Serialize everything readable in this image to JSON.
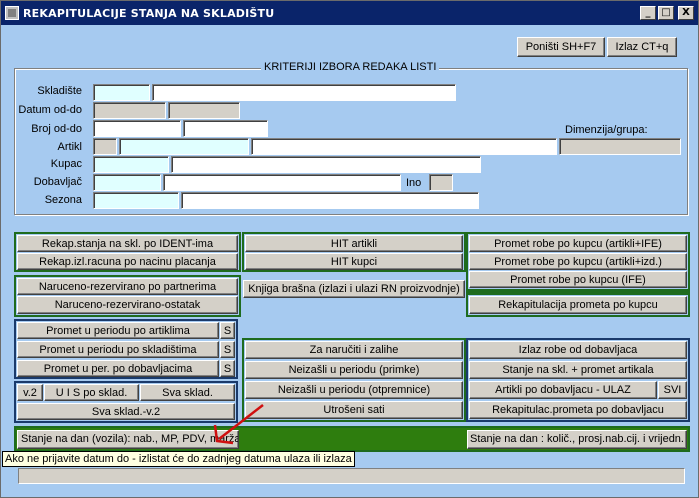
{
  "window": {
    "title": "REKAPITULACIJE STANJA NA SKLADIŠTU",
    "controls": {
      "minimize": "_",
      "maximize": "□",
      "close": "X"
    }
  },
  "top_buttons": {
    "cancel": "Poništi SH+F7",
    "exit": "Izlaz CT+q"
  },
  "criteria": {
    "title": "KRITERIJI IZBORA REDAKA LISTI",
    "labels": {
      "skladiste": "Skladište",
      "datum": "Datum od-do",
      "broj": "Broj od-do",
      "artikl": "Artikl",
      "kupac": "Kupac",
      "dobavljac": "Dobavljač",
      "sezona": "Sezona",
      "ino": "Ino",
      "dimenzija": "Dimenzija/grupa:"
    }
  },
  "buttons": {
    "rekap_ident": "Rekap.stanja na skl. po IDENT-ima",
    "rekap_izl_racuna": "Rekap.izl.racuna po nacinu placanja",
    "hit_artikli": "HIT artikli",
    "hit_kupci": "HIT kupci",
    "promet_kupcu_ife": "Promet robe po kupcu (artikli+IFE)",
    "promet_kupcu_izd": "Promet robe po kupcu (artikli+izd.)",
    "promet_kupcu_samo_ife": "Promet robe po kupcu (IFE)",
    "rekap_prometa_kupcu": "Rekapitulacija prometa po kupcu",
    "naruceno_partner": "Naruceno-rezervirano po partnerima",
    "naruceno_ostatak": "Naruceno-rezervirano-ostatak",
    "knjiga_brasna": "Knjiga brašna (izlazi i ulazi RN proizvodnje)",
    "promet_artikli": "Promet u periodu po artiklima",
    "promet_skladista": "Promet u periodu po skladištima",
    "promet_dobavljaci": "Promet u per. po dobavljacima",
    "s_label": "S",
    "za_naruciti": "Za naručiti i zalihe",
    "neizasli_primke": "Neizašli u periodu (primke)",
    "neizasli_otpremnice": "Neizašli u periodu (otpremnice)",
    "utroseni_sati": "Utrošeni sati",
    "izlaz_robe": "Izlaz robe od dobavljaca",
    "stanje_promet": "Stanje na skl. + promet artikala",
    "artikli_dobavljacu": "Artikli po dobavljacu - ULAZ",
    "svi": "SVI",
    "rekap_dobavljacu": "Rekapitulac.prometa po dobavljacu",
    "v2": "v.2",
    "uis": "U I S po sklad.",
    "sva_sklad": "Sva sklad.",
    "sva_sklad_v2": "Sva sklad.-v.2",
    "stanje_vozila": "Stanje na dan (vozila): nab., MP, PDV, marža",
    "stanje_kolic": "Stanje na dan : količ., prosj.nab.cij. i vrijedn."
  },
  "tooltip": "Ako ne prijavite datum do - izlistat će do zadnjeg datuma ulaza ili izlaza",
  "colors": {
    "window_bg": "#a6caf0",
    "titlebar": "#0a246a",
    "green_group": "#1e6b1e",
    "navy_group": "#1a3a6b",
    "field_light": "#e0ffff",
    "arrow": "#d01010"
  }
}
